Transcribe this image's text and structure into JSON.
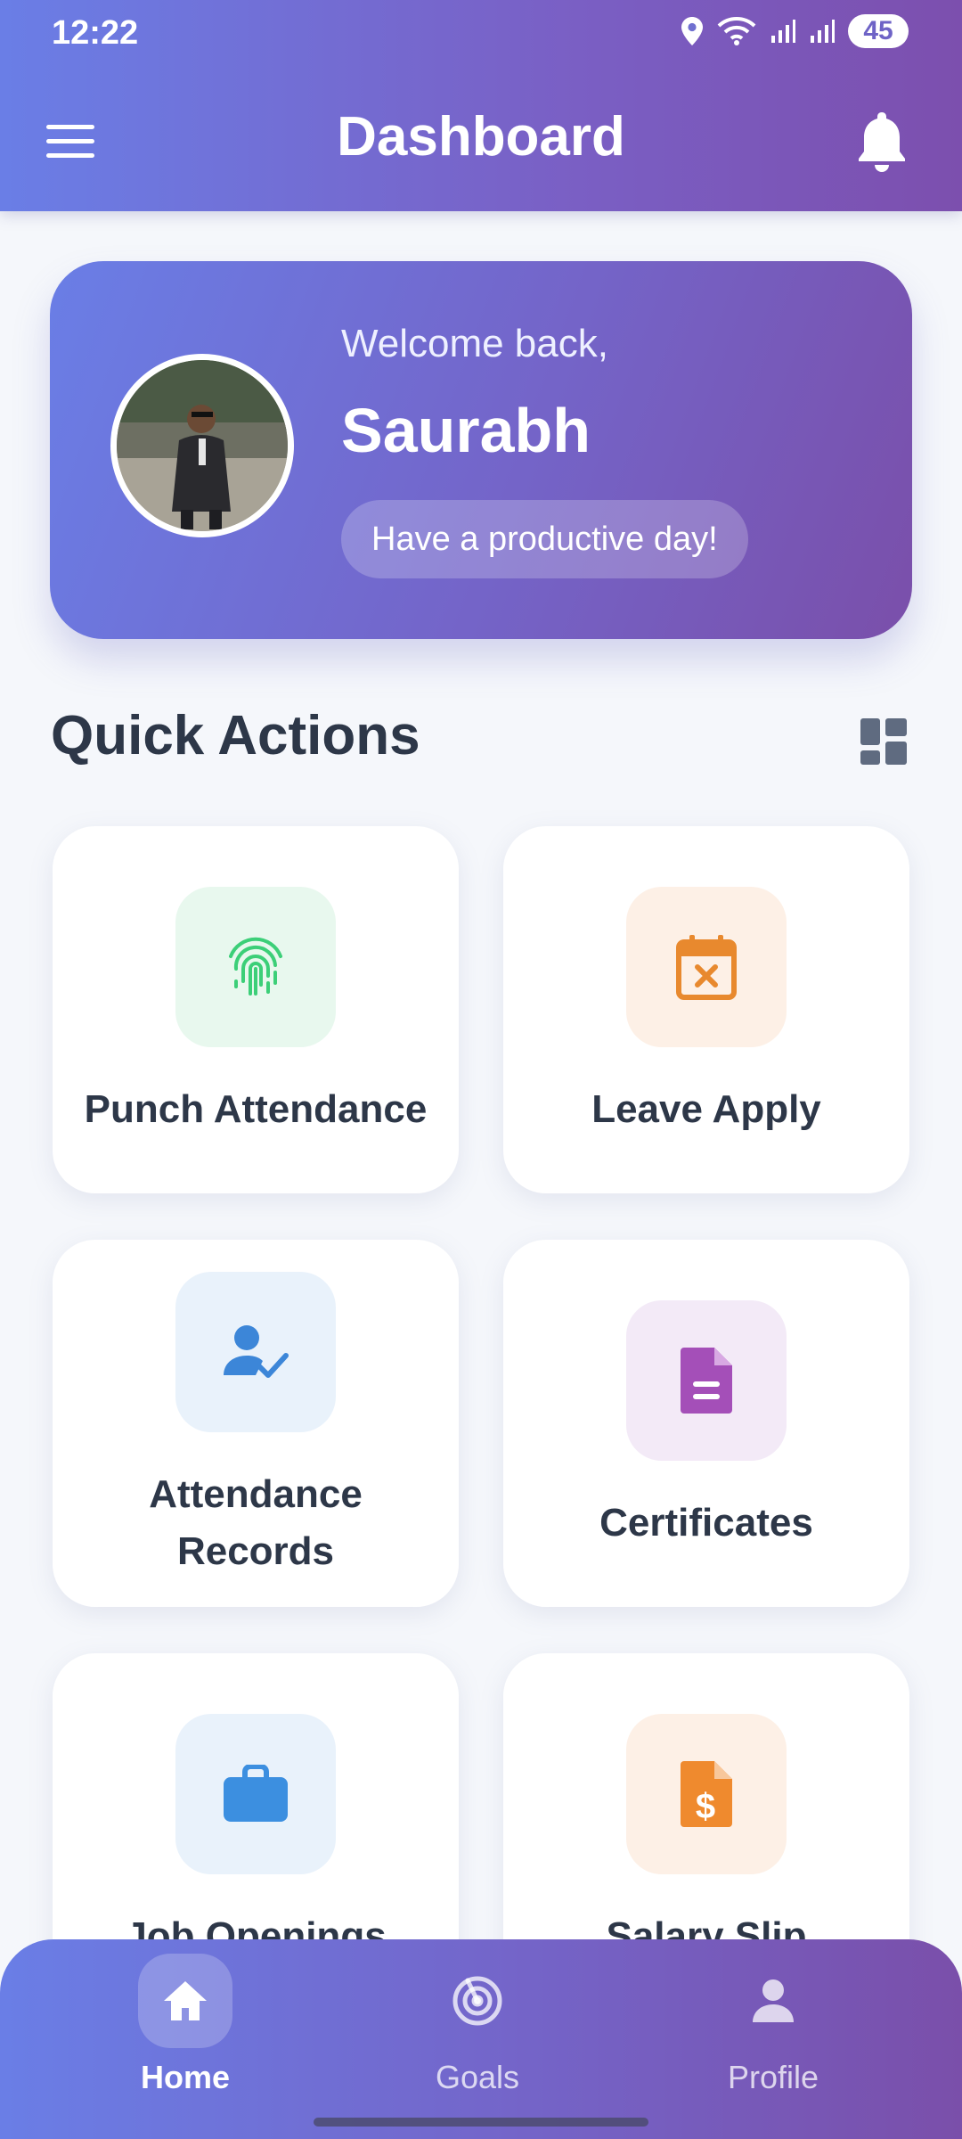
{
  "status_bar": {
    "time": "12:22",
    "battery": "45"
  },
  "header": {
    "title": "Dashboard"
  },
  "welcome": {
    "greeting": "Welcome back,",
    "name": "Saurabh",
    "message": "Have a productive day!"
  },
  "quick_actions": {
    "title": "Quick Actions",
    "items": [
      {
        "label": "Punch Attendance",
        "icon": "fingerprint-icon",
        "tint": "#e8f8ee",
        "color": "#3ccf78"
      },
      {
        "label": "Leave Apply",
        "icon": "calendar-x-icon",
        "tint": "#fdf0e6",
        "color": "#e8892e"
      },
      {
        "label": "Attendance Records",
        "icon": "user-check-icon",
        "tint": "#e9f2fb",
        "color": "#3c86d8"
      },
      {
        "label": "Certificates",
        "icon": "document-icon",
        "tint": "#f3eaf7",
        "color": "#a44fb8"
      },
      {
        "label": "Job Openings",
        "icon": "briefcase-icon",
        "tint": "#e9f2fb",
        "color": "#3c8fe0"
      },
      {
        "label": "Salary Slip",
        "icon": "salary-document-icon",
        "tint": "#fdf0e6",
        "color": "#ef8a2e"
      }
    ]
  },
  "bottom_nav": {
    "items": [
      {
        "label": "Home",
        "icon": "home-icon",
        "active": true
      },
      {
        "label": "Goals",
        "icon": "target-icon",
        "active": false
      },
      {
        "label": "Profile",
        "icon": "person-icon",
        "active": false
      }
    ]
  }
}
